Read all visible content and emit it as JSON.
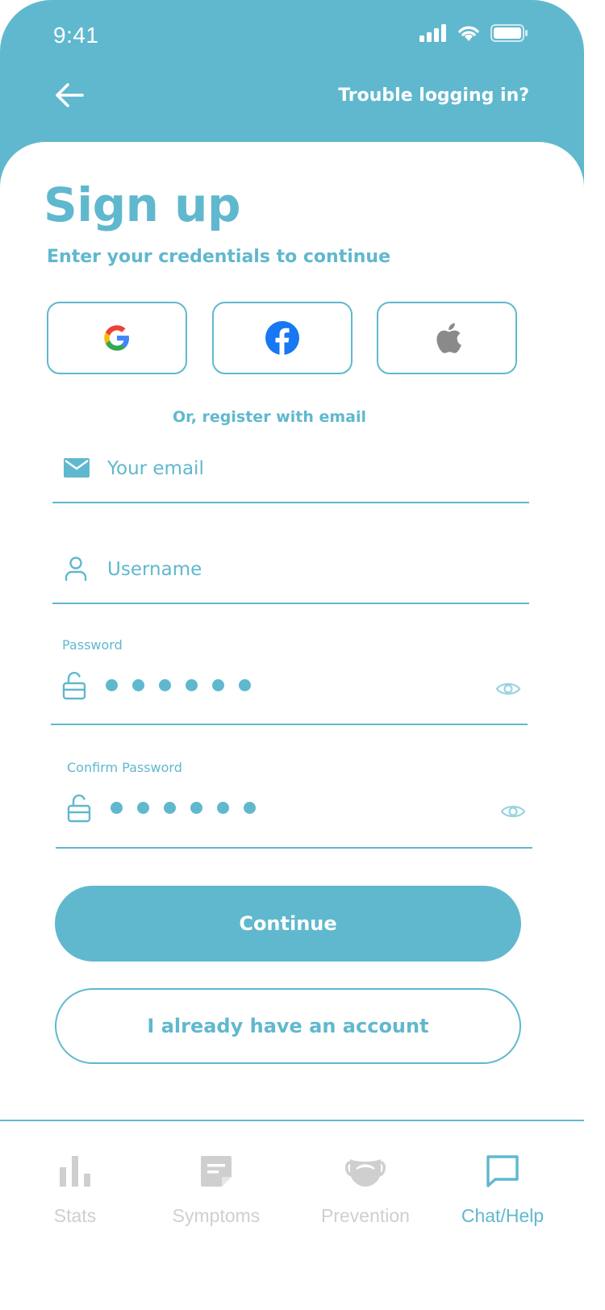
{
  "status_bar": {
    "time": "9:41"
  },
  "header": {
    "trouble_link": "Trouble logging in?"
  },
  "main": {
    "title": "Sign up",
    "subtitle": "Enter your credentials to continue",
    "social_buttons": [
      "google-icon",
      "facebook-icon",
      "apple-icon"
    ],
    "divider_text": "Or, register with email",
    "email": {
      "placeholder": "Your email",
      "value": ""
    },
    "username": {
      "placeholder": "Username",
      "value": ""
    },
    "password": {
      "label": "Password",
      "masked_length": 6
    },
    "confirm_password": {
      "label": "Confirm Password",
      "masked_length": 6
    },
    "continue_label": "Continue",
    "have_account_label": "I already have an account"
  },
  "tabbar": {
    "items": [
      {
        "label": "Stats",
        "icon": "bar-chart-icon",
        "active": false
      },
      {
        "label": "Symptoms",
        "icon": "note-icon",
        "active": false
      },
      {
        "label": "Prevention",
        "icon": "mask-icon",
        "active": false
      },
      {
        "label": "Chat/Help",
        "icon": "chat-bubble-icon",
        "active": true
      }
    ]
  },
  "colors": {
    "accent": "#60b8ce",
    "inactive": "#cfcfcf",
    "white": "#ffffff"
  }
}
